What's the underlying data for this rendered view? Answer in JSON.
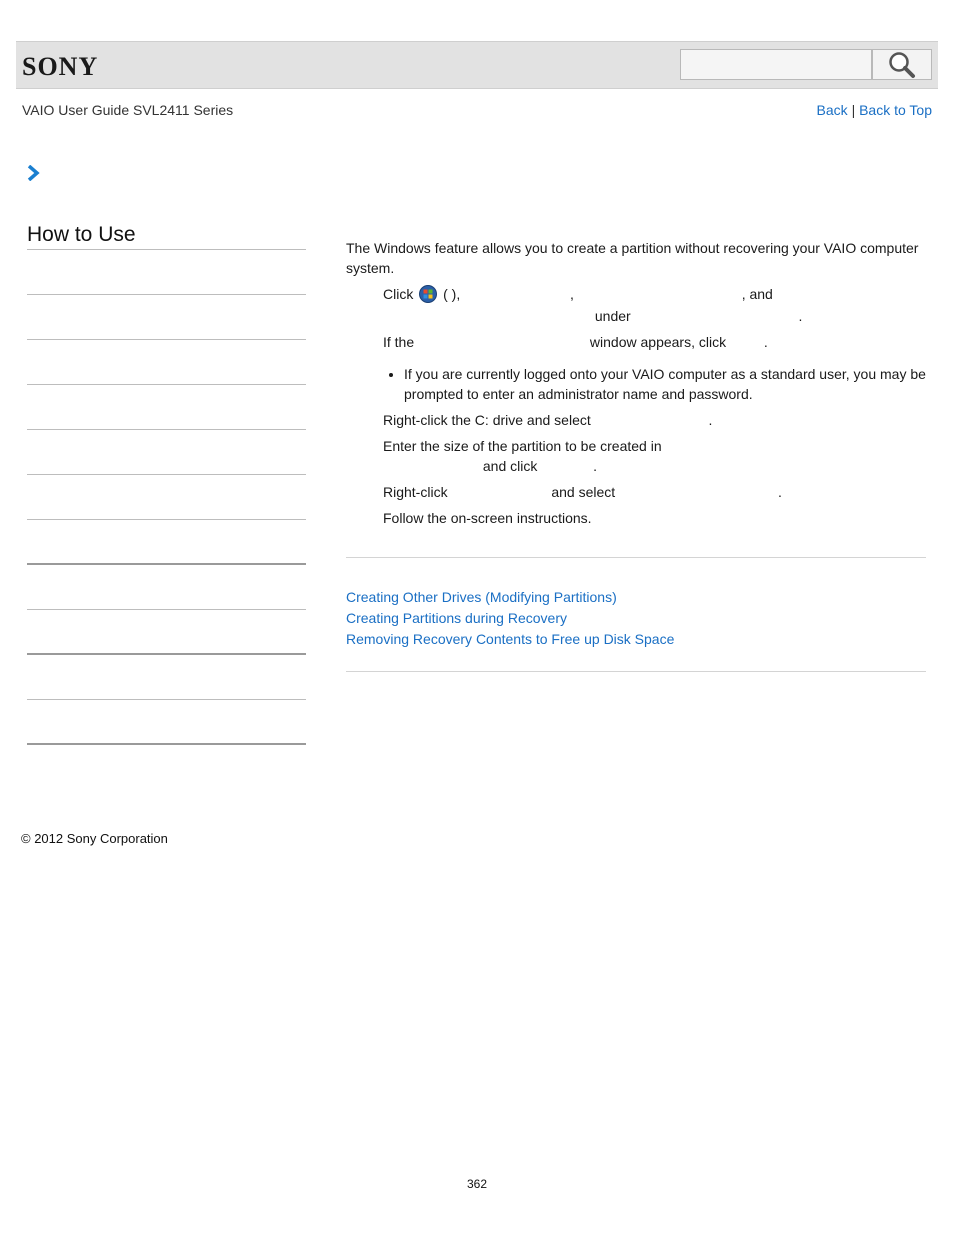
{
  "header": {
    "brand": "SONY",
    "search_placeholder": ""
  },
  "guide_title": "VAIO User Guide SVL2411 Series",
  "nav": {
    "back": "Back",
    "separator": "|",
    "back_to_top": "Back to Top"
  },
  "sidebar": {
    "title": "How to Use",
    "item_count_hint": "12 blank menu entries"
  },
  "content": {
    "intro": "The Windows feature allows you to create a partition without recovering your VAIO computer system.",
    "step1_a": "Click",
    "step1_b": "(        ),",
    "step1_c": ",",
    "step1_d": ", and",
    "step1_e": "under",
    "step1_f": ".",
    "step2_a": "If the",
    "step2_b": "window appears, click",
    "step2_c": ".",
    "note": "If you are currently logged onto your VAIO computer as a standard user, you may be prompted to enter an administrator name and password.",
    "step3_a": "Right-click the C: drive and select",
    "step3_b": ".",
    "step4_a": "Enter the size of the partition to be created in",
    "step4_b": "and click",
    "step4_c": ".",
    "step5_a": "Right-click",
    "step5_b": "and select",
    "step5_c": ".",
    "step6": "Follow the on-screen instructions."
  },
  "related_links": [
    "Creating Other Drives (Modifying Partitions)",
    "Creating Partitions during Recovery",
    "Removing Recovery Contents to Free up Disk Space"
  ],
  "footer": {
    "copyright": "© 2012 Sony Corporation",
    "page_number": "362"
  },
  "colors": {
    "link": "#1a6fc4",
    "header_bg": "#e2e2e2",
    "chevron": "#1a7fd0"
  }
}
